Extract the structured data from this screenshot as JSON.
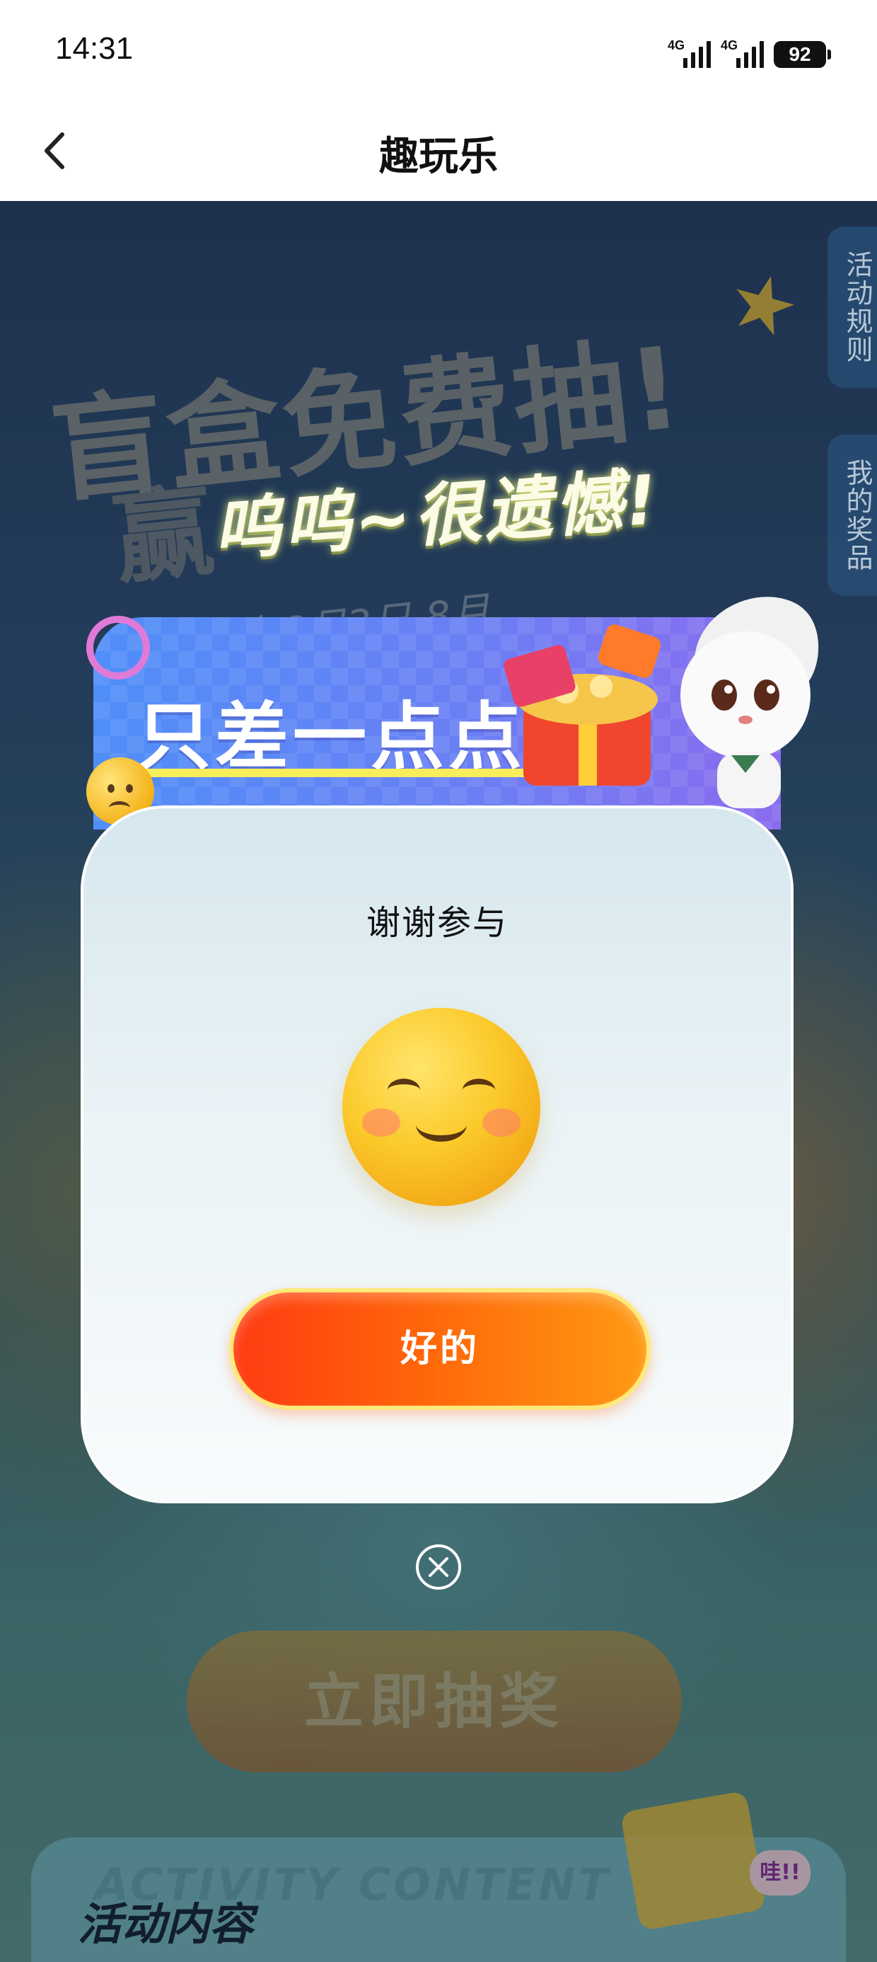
{
  "status_bar": {
    "time": "14:31",
    "network_1": "4G",
    "network_2": "4G",
    "battery": "92"
  },
  "header": {
    "title": "趣玩乐"
  },
  "background": {
    "headline": "盲盒免费抽!",
    "subline": "赢",
    "date_text": "2026年8月3日-8月",
    "rules_tab": "活动规则",
    "prizes_tab": "我的奖品",
    "draw_button": "立即抽奖",
    "activity_en": "ACTIVITY CONTENT",
    "activity_title": "活动内容",
    "gift_bubble": "哇!!"
  },
  "popup": {
    "banner_text": "只差一点点",
    "banner_overlay": "呜呜~很遗憾!",
    "title": "谢谢参与",
    "ok_button": "好的"
  },
  "colors": {
    "ok_button_start": "#ff3b12",
    "ok_button_end": "#ff9a14",
    "banner_start": "#4f8ef8",
    "banner_end": "#8a6cee"
  },
  "icons": {
    "back": "back-arrow-icon",
    "close": "close-circle-icon",
    "smile": "smile-emoji-icon",
    "worried": "worried-emoji-icon"
  }
}
